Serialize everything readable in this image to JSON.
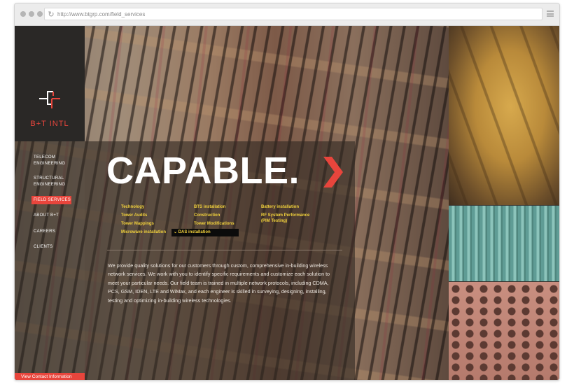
{
  "browser": {
    "url": "http://www.btgrp.com/field_services"
  },
  "logo": {
    "text": "B+T INTL"
  },
  "nav": {
    "items": [
      {
        "label": "TELECOM\nENGINEERING"
      },
      {
        "label": "STRUCTURAL\nENGINEERING"
      },
      {
        "label": "FIELD SERVICES",
        "active": true
      },
      {
        "label": "ABOUT B+T"
      },
      {
        "label": "CAREERS"
      },
      {
        "label": "CLIENTS"
      }
    ]
  },
  "hero": {
    "headline": "CAPABLE."
  },
  "services": {
    "col1": [
      "Technology",
      "Tower Audits",
      "Tower Mappings",
      "Microwave installation"
    ],
    "col2": [
      "BTS installation",
      "Construction",
      "Tower Modifications"
    ],
    "col2_selected": "DAS installation",
    "col3": [
      "Battery installation",
      "RF System Performance\n(PIM Testing)"
    ]
  },
  "description": "We provide quality solutions for our customers through custom, comprehensive in-building wireless network services. We work with you to identify specific requirements and customize each solution to meet your particular needs. Our field team is trained in multiple network protocols, including CDMA, PCS, GSM, IDEN, LTE and WiMax, and each engineer is skilled in surveying, designing, installing, testing and optimizing in-building wireless technologies.",
  "contact_button": "View Contact Information",
  "colors": {
    "accent": "#e8453c",
    "service_text": "#f2d23c",
    "logo_bg": "#2a2826"
  }
}
